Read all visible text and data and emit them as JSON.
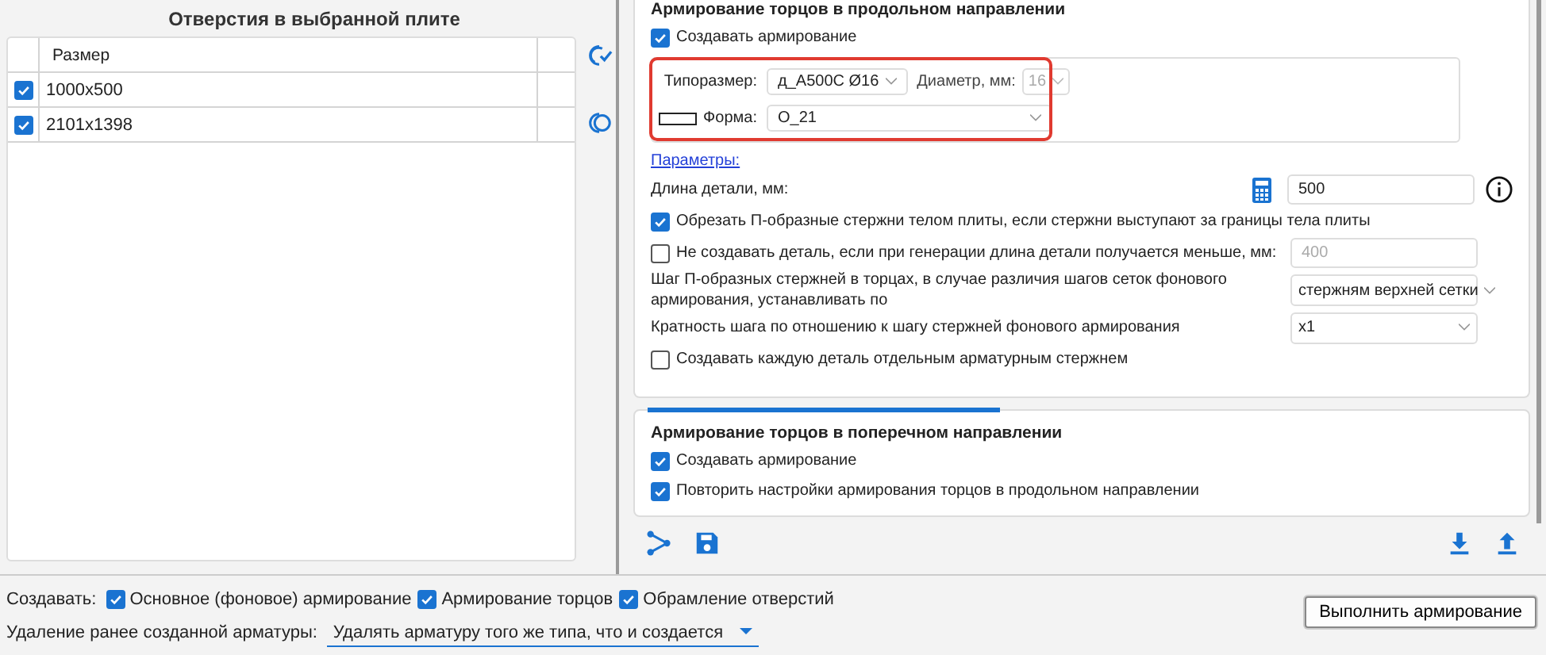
{
  "holes_panel": {
    "title": "Отверстия в выбранной плите",
    "columns": [
      "Размер"
    ],
    "rows": [
      {
        "checked": true,
        "size": "1000x500"
      },
      {
        "checked": true,
        "size": "2101x1398"
      }
    ]
  },
  "longitudinal": {
    "title": "Армирование торцов в продольном направлении",
    "create": {
      "label": "Создавать армирование",
      "checked": true
    },
    "typesize": {
      "label": "Типоразмер:",
      "value": "д_А500С Ø16"
    },
    "diameter": {
      "label": "Диаметр, мм:",
      "value": "16",
      "disabled": true
    },
    "shape": {
      "label": "Форма:",
      "value": "О_21"
    },
    "params_link": "Параметры:",
    "length": {
      "label": "Длина детали, мм:",
      "value": "500"
    },
    "trim": {
      "label": "Обрезать П-образные стержни телом плиты, если стержни выступают за границы тела плиты",
      "checked": true
    },
    "min_length": {
      "label": "Не создавать деталь, если при генерации длина детали получается меньше, мм:",
      "checked": false,
      "value": "400",
      "disabled": true
    },
    "step": {
      "label": "Шаг П-образных стержней в торцах, в случае различия шагов сеток фонового армирования, устанавливать по",
      "value": "стержням верхней сетки"
    },
    "multiplicity": {
      "label": "Кратность шага по отношению к шагу стержней фонового армирования",
      "value": "x1"
    },
    "separate": {
      "label": "Создавать каждую деталь отдельным арматурным стержнем",
      "checked": false
    }
  },
  "transverse": {
    "title": "Армирование торцов в поперечном направлении",
    "options": [
      {
        "label": "Создавать армирование",
        "checked": true
      },
      {
        "label": "Повторить настройки армирования торцов в продольном направлении",
        "checked": true
      }
    ]
  },
  "bottom": {
    "create_label": "Создавать:",
    "create_options": [
      {
        "label": "Основное (фоновое) армирование",
        "checked": true
      },
      {
        "label": "Армирование торцов",
        "checked": true
      },
      {
        "label": "Обрамление отверстий",
        "checked": true
      }
    ],
    "delete_label": "Удаление ранее созданной арматуры:",
    "delete_value": "Удалять арматуру того же типа, что и создается",
    "run_button": "Выполнить армирование"
  }
}
